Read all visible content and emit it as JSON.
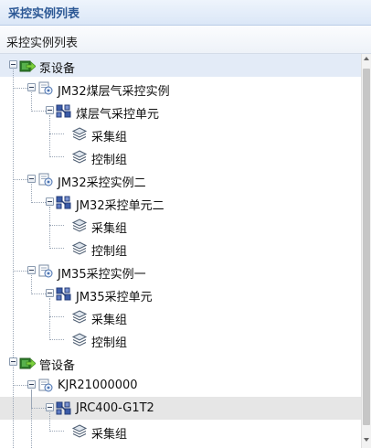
{
  "panel": {
    "title": "采控实例列表"
  },
  "list": {
    "header": "采控实例列表"
  },
  "tree": [
    {
      "label": "泵设备",
      "icon": "device-arrow-icon",
      "level": 0,
      "expanded": true,
      "selected": true
    },
    {
      "label": "JM32煤层气采控实例",
      "icon": "instance-icon",
      "level": 1,
      "expanded": true
    },
    {
      "label": "煤层气采控单元",
      "icon": "unit-icon",
      "level": 2,
      "expanded": true
    },
    {
      "label": "采集组",
      "icon": "layers-icon",
      "level": 3
    },
    {
      "label": "控制组",
      "icon": "layers-icon",
      "level": 3
    },
    {
      "label": "JM32采控实例二",
      "icon": "instance-icon",
      "level": 1,
      "expanded": true
    },
    {
      "label": "JM32采控单元二",
      "icon": "unit-icon",
      "level": 2,
      "expanded": true
    },
    {
      "label": "采集组",
      "icon": "layers-icon",
      "level": 3
    },
    {
      "label": "控制组",
      "icon": "layers-icon",
      "level": 3
    },
    {
      "label": "JM35采控实例一",
      "icon": "instance-icon",
      "level": 1,
      "expanded": true
    },
    {
      "label": "JM35采控单元",
      "icon": "unit-icon",
      "level": 2,
      "expanded": true
    },
    {
      "label": "采集组",
      "icon": "layers-icon",
      "level": 3
    },
    {
      "label": "控制组",
      "icon": "layers-icon",
      "level": 3
    },
    {
      "label": "管设备",
      "icon": "device-arrow-icon",
      "level": 0,
      "expanded": true
    },
    {
      "label": "KJR21000000",
      "icon": "instance-icon",
      "level": 1,
      "expanded": true
    },
    {
      "label": "JRC400-G1T2",
      "icon": "unit-icon",
      "level": 2,
      "expanded": true,
      "hover": true
    },
    {
      "label": "采集组",
      "icon": "layers-icon",
      "level": 3
    }
  ],
  "colors": {
    "header_title": "#2c5895",
    "selected_row": "#e3ebf7",
    "hover_row": "#e6e6e6"
  }
}
